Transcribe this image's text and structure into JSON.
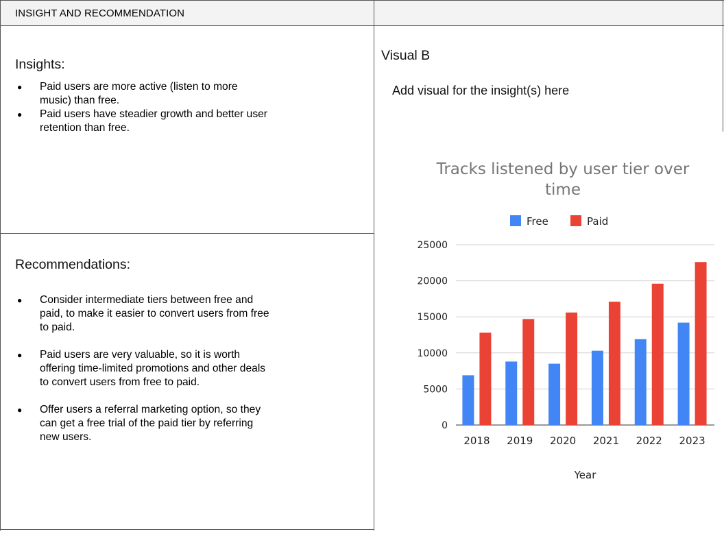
{
  "header": {
    "title": "INSIGHT AND RECOMMENDATION"
  },
  "insights": {
    "title": "Insights:",
    "items": [
      "Paid users are more active (listen to more\nmusic) than free.",
      "Paid users have steadier growth and better user\nretention than free."
    ]
  },
  "recommendations": {
    "title": "Recommendations:",
    "items": [
      "Consider intermediate tiers between free and\npaid, to make it easier to convert users from free\nto paid.",
      "Paid users are very valuable, so it is worth\noffering time-limited promotions and other deals\nto convert users from free to paid.",
      "Offer users a referral marketing option, so they\ncan get a free trial of the paid tier by referring\nnew users."
    ]
  },
  "visual": {
    "title": "Visual B",
    "placeholder": "Add visual for the insight(s) here"
  },
  "chart_data": {
    "type": "bar",
    "title": "Tracks listened by user tier over time",
    "categories": [
      "2018",
      "2019",
      "2020",
      "2021",
      "2022",
      "2023"
    ],
    "series": [
      {
        "name": "Free",
        "color": "#4285f4",
        "values": [
          6900,
          8800,
          8500,
          10300,
          11900,
          14200
        ]
      },
      {
        "name": "Paid",
        "color": "#ea4335",
        "values": [
          12800,
          14700,
          15600,
          17100,
          19600,
          22600
        ]
      }
    ],
    "xlabel": "Year",
    "ylabel": "",
    "ylim": [
      0,
      25000
    ],
    "yticks": [
      0,
      5000,
      10000,
      15000,
      20000,
      25000
    ],
    "grid": true,
    "legend": "top"
  }
}
